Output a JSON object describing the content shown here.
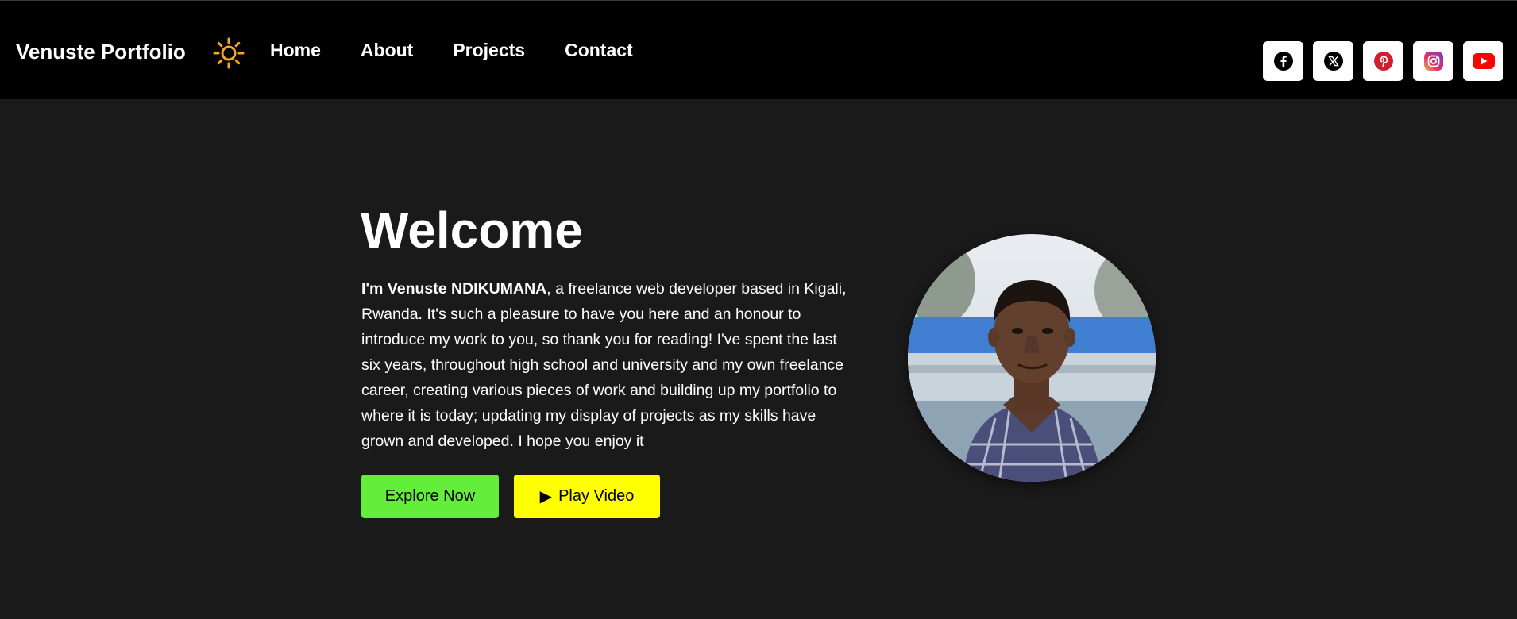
{
  "header": {
    "brand": "Venuste Portfolio",
    "theme_icon": "sun-icon",
    "nav": [
      {
        "label": "Home"
      },
      {
        "label": "About"
      },
      {
        "label": "Projects"
      },
      {
        "label": "Contact"
      }
    ],
    "socials": [
      {
        "name": "facebook-icon"
      },
      {
        "name": "x-twitter-icon"
      },
      {
        "name": "pinterest-icon"
      },
      {
        "name": "instagram-icon"
      },
      {
        "name": "youtube-icon"
      }
    ]
  },
  "hero": {
    "title": "Welcome",
    "intro_name": "I'm Venuste NDIKUMANA",
    "intro_text": ", a freelance web developer based in Kigali, Rwanda. It's such a pleasure to have you here and an honour to introduce my work to you, so thank you for reading! I've spent the last six years, throughout high school and university and my own freelance career, creating various pieces of work and building up my portfolio to where it is today; updating my display of projects as my skills have grown and developed. I hope you enjoy it",
    "explore_label": "Explore Now",
    "play_label": "Play Video",
    "play_icon": "▶"
  },
  "colors": {
    "page_bg": "#1a1a1a",
    "header_bg": "#000000",
    "explore_bg": "#64ee3c",
    "play_bg": "#ffff00",
    "sun": "#f5a623"
  }
}
